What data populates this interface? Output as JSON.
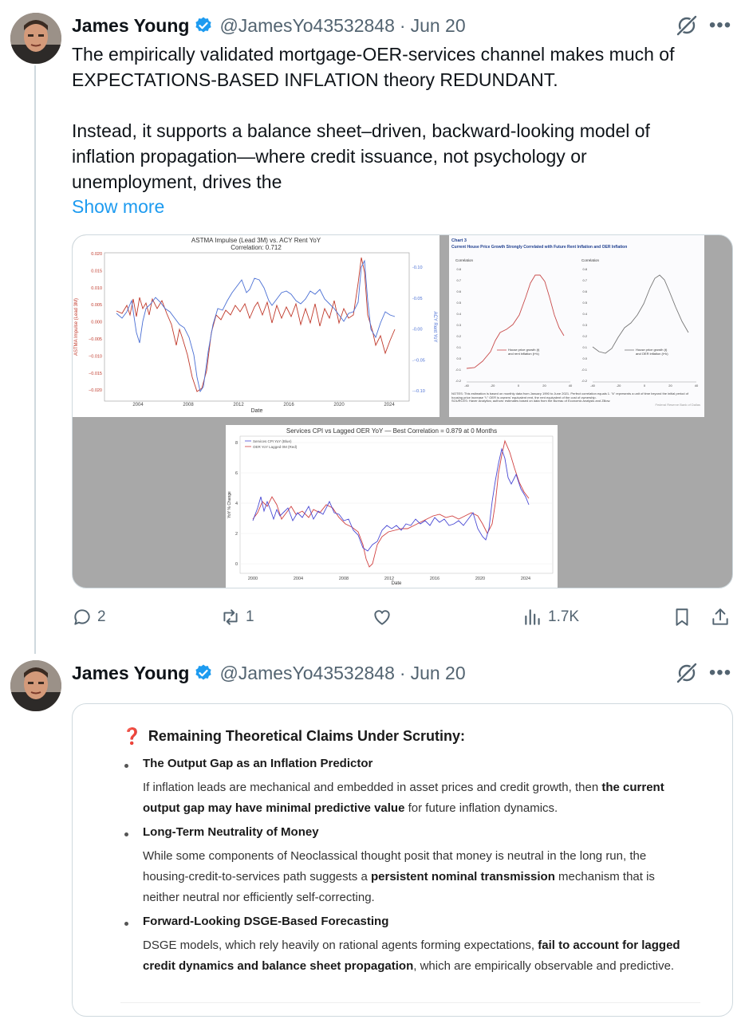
{
  "tweet1": {
    "name": "James Young",
    "handle": "@JamesYo43532848",
    "date": "Jun 20",
    "text_line1": "The empirically validated mortgage-OER-services channel makes much of",
    "text_line2": "EXPECTATIONS-BASED INFLATION theory REDUNDANT.",
    "text_line3": "Instead, it supports a balance sheet–driven, backward-looking model of",
    "text_line4": "inflation propagation—where credit issuance, not psychology or",
    "text_line5": "unemployment, drives the",
    "show_more": "Show more",
    "replies": "2",
    "reposts": "1",
    "views": "1.7K"
  },
  "tweet2": {
    "name": "James Young",
    "handle": "@JamesYo43532848",
    "date": "Jun 20"
  },
  "chart1": {
    "title": "ASTMA Impulse (Lead 3M) vs. ACY Rent YoY",
    "subtitle": "Correlation: 0.712",
    "ylabel_left": "ASTMA Impulse (Lead 3M)",
    "ylabel_right": "ACY Rent YoY",
    "xlabel": "Date",
    "left_ticks": [
      "0.020",
      "0.015",
      "0.010",
      "0.005",
      "0.000",
      "−0.005",
      "−0.010",
      "−0.015",
      "−0.020"
    ],
    "right_ticks": [
      "0.10",
      "0.05",
      "0.00",
      "−0.05",
      "−0.10"
    ],
    "x_ticks": [
      "2004",
      "2008",
      "2012",
      "2016",
      "2020",
      "2024"
    ]
  },
  "chart2": {
    "label": "Chart 3",
    "title": "Current House Price Growth Strongly Correlated with Future Rent Inflation and OER Inflation",
    "ylabel": "Correlation",
    "y_ticks": [
      "0.8",
      "0.7",
      "0.6",
      "0.5",
      "0.4",
      "0.3",
      "0.2",
      "0.1",
      "0.0",
      "-0.1",
      "-0.2"
    ],
    "x_ticks": [
      "-40",
      "-20",
      "0",
      "20",
      "40"
    ],
    "left_legend_line1": "House price growth (t)",
    "left_legend_line2": "and rent inflation (t+k)",
    "right_legend_line1": "House price growth (t)",
    "right_legend_line2": "and OER inflation (t+k)",
    "notes": "NOTES: This estimation is based on monthly data from January 1990 to June 2021. Perfect correlation equals 1. \"k\" represents a unit of time beyond the initial period of housing price increase \"t.\" OER is owners' equivalent rent, the rent equivalent of the cost of ownership.",
    "sources": "SOURCES: Haver Analytics; authors' estimates based on data from the Bureau of Economic Analysis and Zillow.",
    "credit": "Federal Reserve Bank of Dallas"
  },
  "chart3": {
    "title": "Services CPI vs Lagged OER YoY — Best Correlation = 0.879 at 0 Months",
    "legend_blue": "Services CPI YoY (Blue)",
    "legend_red": "OER YoY Lagged 0M (Red)",
    "ylabel": "YoY % Change",
    "xlabel": "Date",
    "y_ticks": [
      "8",
      "6",
      "4",
      "2",
      "0"
    ],
    "x_ticks": [
      "2000",
      "2004",
      "2008",
      "2012",
      "2016",
      "2020",
      "2024"
    ]
  },
  "quote": {
    "title": "Remaining Theoretical Claims Under Scrutiny:",
    "items": [
      {
        "title": "The Output Gap as an Inflation Predictor",
        "l1a": "If inflation leads are mechanical and embedded in asset prices and credit growth, then ",
        "l1b": "the current",
        "l2a": "output gap may have minimal predictive value",
        "l2b": " for future inflation dynamics."
      },
      {
        "title": "Long-Term Neutrality of Money",
        "l1a": "While some components of Neoclassical thought posit that money is neutral in the long run, the",
        "l2a": "housing-credit-to-services path suggests a ",
        "l2b": "persistent nominal transmission",
        "l2c": " mechanism that is",
        "l3a": "neither neutral nor efficiently self-correcting."
      },
      {
        "title": "Forward-Looking DSGE-Based Forecasting",
        "l1a": "DSGE models, which rely heavily on rational agents forming expectations, ",
        "l1b": "fail to account for lagged",
        "l2a": "credit dynamics and balance sheet propagation",
        "l2b": ", which are empirically observable and predictive."
      }
    ]
  },
  "colors": {
    "link": "#1d9bf0",
    "muted": "#536471",
    "verified": "#1d9bf0",
    "series_red": "#c0392b",
    "series_blue": "#4a6fd4"
  }
}
